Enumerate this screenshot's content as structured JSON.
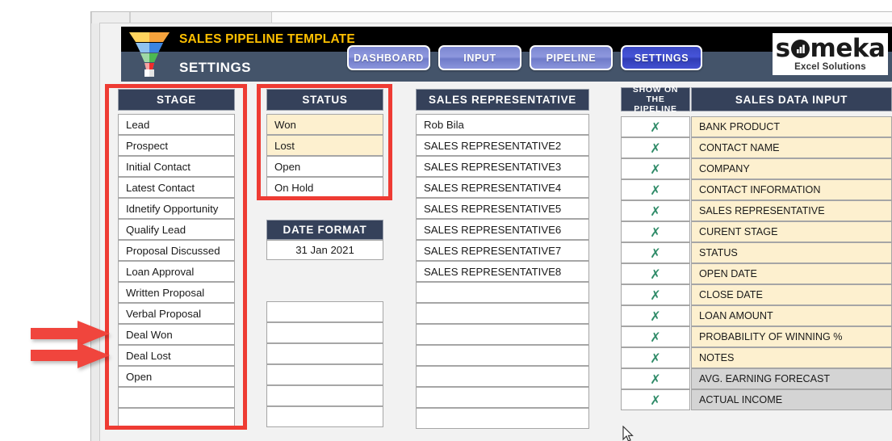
{
  "header": {
    "title": "SALES PIPELINE TEMPLATE",
    "subtitle": "SETTINGS",
    "logo_icon": "funnel-icon",
    "brand": {
      "name": "someka",
      "tagline": "Excel Solutions",
      "icon": "bar-chart-icon"
    },
    "nav": [
      {
        "label": "DASHBOARD",
        "active": false
      },
      {
        "label": "INPUT",
        "active": false
      },
      {
        "label": "PIPELINE",
        "active": false
      },
      {
        "label": "SETTINGS",
        "active": true
      }
    ]
  },
  "stage": {
    "header": "STAGE",
    "items": [
      "Lead",
      "Prospect",
      "Initial Contact",
      "Latest Contact",
      "Idnetify Opportunity",
      "Qualify Lead",
      "Proposal Discussed",
      "Loan Approval",
      "Written Proposal",
      "Verbal Proposal",
      "Deal Won",
      "Deal Lost",
      "Open",
      "",
      ""
    ]
  },
  "status": {
    "header": "STATUS",
    "items": [
      {
        "label": "Won",
        "highlight": true
      },
      {
        "label": "Lost",
        "highlight": true
      },
      {
        "label": "Open",
        "highlight": false
      },
      {
        "label": "On Hold",
        "highlight": false
      }
    ]
  },
  "date_format": {
    "header": "DATE FORMAT",
    "value": "31 Jan 2021"
  },
  "extra_box": {
    "rows": [
      "",
      "",
      "",
      "",
      "",
      ""
    ]
  },
  "sales_representative": {
    "header": "SALES REPRESENTATIVE",
    "items": [
      "Rob Bila",
      "SALES REPRESENTATIVE2",
      "SALES REPRESENTATIVE3",
      "SALES REPRESENTATIVE4",
      "SALES REPRESENTATIVE5",
      "SALES REPRESENTATIVE6",
      "SALES REPRESENTATIVE7",
      "SALES REPRESENTATIVE8",
      "",
      "",
      "",
      "",
      "",
      "",
      ""
    ]
  },
  "sales_data_input": {
    "show_header": "SHOW ON THE PIPELINE",
    "header": "SALES DATA INPUT",
    "check_mark": "✗",
    "rows": [
      {
        "label": "BANK PRODUCT",
        "show": true,
        "shade": "cream"
      },
      {
        "label": "CONTACT NAME",
        "show": true,
        "shade": "cream"
      },
      {
        "label": "COMPANY",
        "show": true,
        "shade": "cream"
      },
      {
        "label": "CONTACT INFORMATION",
        "show": true,
        "shade": "cream"
      },
      {
        "label": "SALES REPRESENTATIVE",
        "show": true,
        "shade": "cream"
      },
      {
        "label": "CURENT STAGE",
        "show": true,
        "shade": "cream"
      },
      {
        "label": "STATUS",
        "show": true,
        "shade": "cream"
      },
      {
        "label": "OPEN DATE",
        "show": true,
        "shade": "cream"
      },
      {
        "label": "CLOSE DATE",
        "show": true,
        "shade": "cream"
      },
      {
        "label": "LOAN AMOUNT",
        "show": true,
        "shade": "cream"
      },
      {
        "label": "PROBABILITY OF WINNING %",
        "show": true,
        "shade": "cream"
      },
      {
        "label": "NOTES",
        "show": true,
        "shade": "cream"
      },
      {
        "label": "AVG. EARNING FORECAST",
        "show": true,
        "shade": "grey"
      },
      {
        "label": "ACTUAL INCOME",
        "show": true,
        "shade": "grey"
      }
    ]
  },
  "annotations": {
    "box_color": "#ee3b33",
    "arrow_color": "#f0453d",
    "arrow_targets": [
      "Deal Won",
      "Deal Lost"
    ]
  },
  "colors": {
    "header_navy": "#35415a",
    "banner_navy": "#44546a",
    "banner_black": "#000000",
    "title_gold": "#ffc000",
    "button_blue": "#8e98de",
    "button_active_blue": "#3a48c4",
    "cream": "#fdf0cf",
    "grey": "#d4d4d4",
    "check_green": "#2f8b68"
  }
}
